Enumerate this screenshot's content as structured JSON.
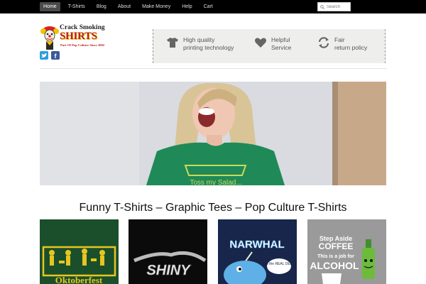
{
  "nav": {
    "items": [
      {
        "label": "Home",
        "active": true
      },
      {
        "label": "T-Shirts",
        "active": false
      },
      {
        "label": "Blog",
        "active": false
      },
      {
        "label": "About",
        "active": false
      },
      {
        "label": "Make Money",
        "active": false
      },
      {
        "label": "Help",
        "active": false
      },
      {
        "label": "Cart",
        "active": false
      }
    ],
    "search_placeholder": "Search"
  },
  "logo": {
    "line1": "Crack Smoking",
    "line2": "SHIRTS",
    "tagline": "Part Of Pop Culture Since 2002"
  },
  "social": {
    "twitter_icon": "twitter-icon",
    "facebook_icon": "facebook-icon"
  },
  "features": [
    {
      "icon": "tshirt-icon",
      "line1": "High quality",
      "line2": "printing technology"
    },
    {
      "icon": "heart-icon",
      "line1": "Helpful",
      "line2": "Service"
    },
    {
      "icon": "refresh-icon",
      "line1": "Fair",
      "line2": "return policy"
    }
  ],
  "hero": {
    "shirt_text": "Toss my Salad..."
  },
  "main_title": "Funny T-Shirts – Graphic Tees – Pop Culture T-Shirts",
  "products": [
    {
      "name": "oktoberfest",
      "text": "Oktoberfest",
      "bg": "#1b4f2b"
    },
    {
      "name": "shiny",
      "text": "SHINY",
      "bg": "#0b0b0b"
    },
    {
      "name": "narwhal",
      "text": "NARWHAL",
      "speech": "I'm the REAL DEAL",
      "bg": "#17264a"
    },
    {
      "name": "coffee-alcohol",
      "text1": "Step Aside",
      "text2": "COFFEE",
      "text3": "This is a job for",
      "text4": "ALCOHOL",
      "bg": "#9a9a9a"
    }
  ],
  "colors": {
    "topbar": "#000000",
    "accent_red": "#b81d1d",
    "feature_bg": "#eeeeec"
  }
}
